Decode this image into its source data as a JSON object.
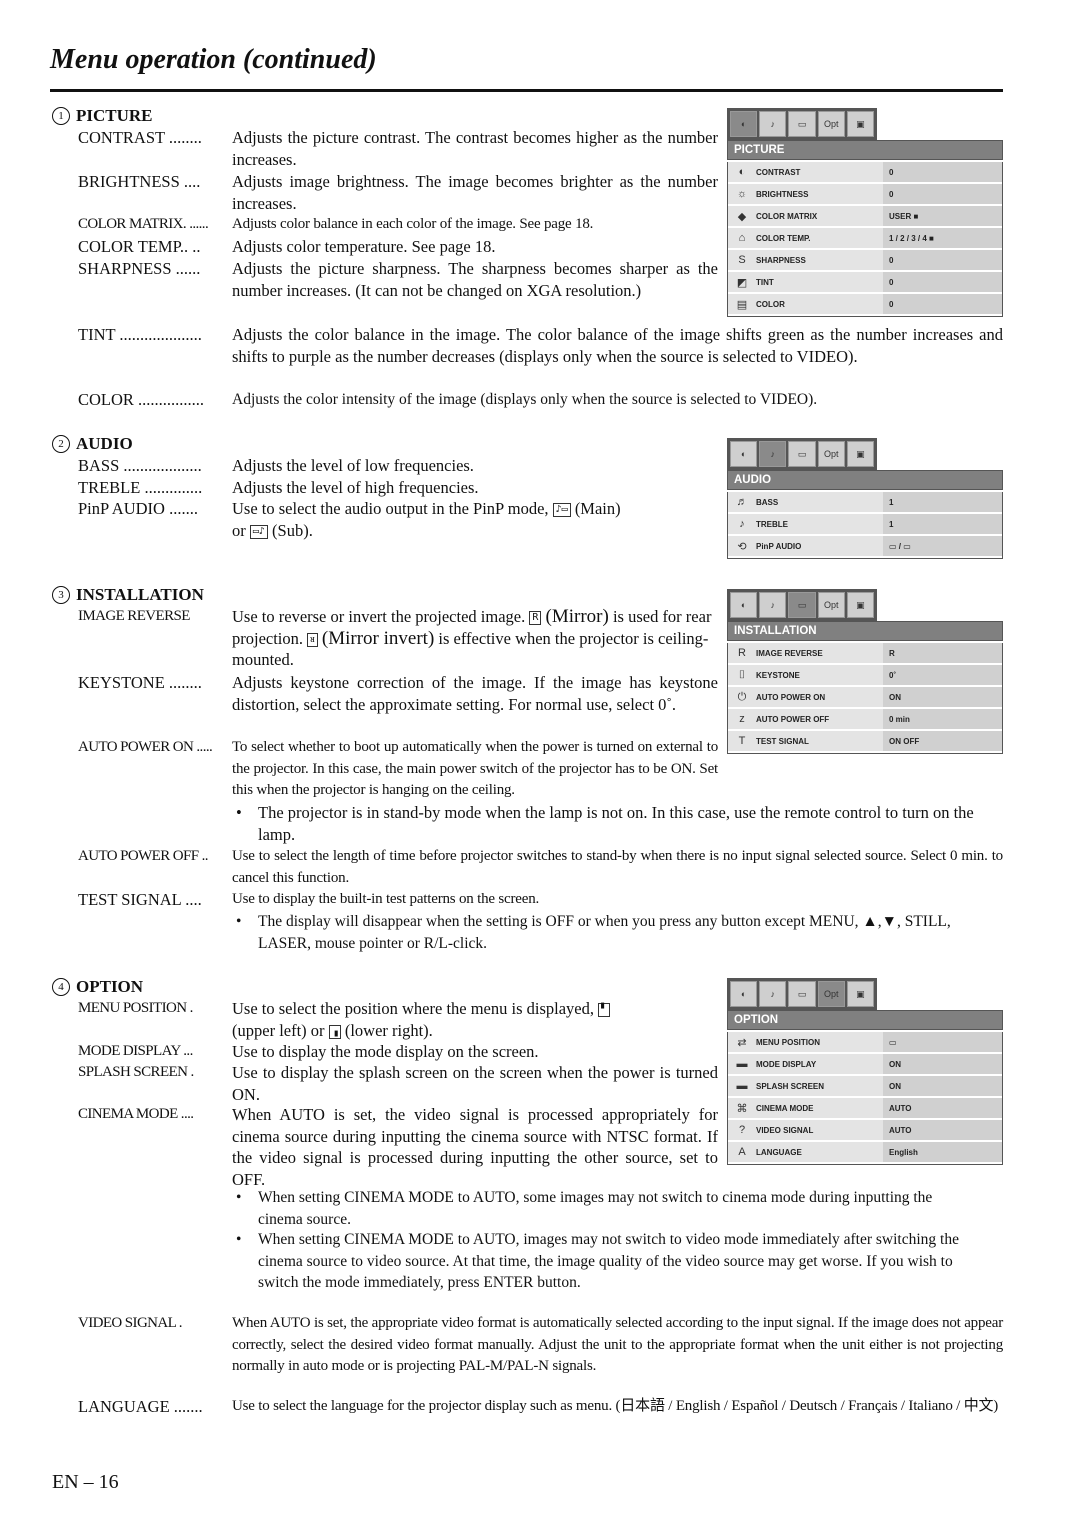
{
  "title": "Menu operation (continued)",
  "page_number": "EN – 16",
  "sections": {
    "picture": {
      "num": "1",
      "heading": "PICTURE",
      "entries": [
        {
          "label": "CONTRAST ........",
          "desc": "Adjusts the picture contrast. The contrast becomes higher as the number increases."
        },
        {
          "label": "BRIGHTNESS ....",
          "desc": "Adjusts image brightness. The image becomes brighter as the number increases."
        },
        {
          "label": "COLOR MATRIX. ......",
          "desc": "Adjusts color balance in each color of the image. See page 18."
        },
        {
          "label": "COLOR TEMP.. ..",
          "desc": "Adjusts color temperature. See page 18."
        },
        {
          "label": "SHARPNESS ......",
          "desc": "Adjusts the picture sharpness. The sharpness becomes sharper as the number increases. (It can not be changed on XGA resolution.)"
        },
        {
          "label": "TINT ....................",
          "desc": "Adjusts the color balance in the image. The color balance of the image shifts green as the number increases and shifts to purple as the number decreases (displays only when the source is selected to VIDEO)."
        },
        {
          "label": "COLOR ................",
          "desc": "Adjusts the color intensity of the image (displays only when the source is selected to VIDEO)."
        }
      ]
    },
    "audio": {
      "num": "2",
      "heading": "AUDIO",
      "entries": [
        {
          "label": "BASS ...................",
          "desc": "Adjusts the level of low frequencies."
        },
        {
          "label": "TREBLE ..............",
          "desc": "Adjusts the level of high frequencies."
        },
        {
          "label": "PinP AUDIO .......",
          "desc_a": "Use to select the audio output in the PinP mode,",
          "main": "(Main)",
          "desc_b": "or",
          "sub": "(Sub)."
        }
      ]
    },
    "installation": {
      "num": "3",
      "heading": "INSTALLATION",
      "entries": [
        {
          "label": "IMAGE REVERSE",
          "desc_a": "Use to reverse or invert the projected image.",
          "mirror": "(Mirror)",
          "desc_b": "is used for rear projection.",
          "mirror_invert": "(Mirror invert)",
          "desc_c": "is effective when the projector is ceiling-mounted."
        },
        {
          "label": "KEYSTONE ........",
          "desc": "Adjusts keystone correction of the image. If the image has keystone distortion, select the approximate setting. For normal use, select 0˚."
        },
        {
          "label": "AUTO POWER ON .....",
          "desc": "To select whether to boot up automatically when the power is turned on external to the projector. In this case, the main power switch of the projector has to be ON. Set this when the projector is hanging on the ceiling."
        },
        {
          "label": "AUTO POWER OFF ..",
          "desc": "Use to select the length of time before projector switches to stand-by when there is no input signal selected source. Select 0 min. to cancel this function."
        },
        {
          "label": "TEST SIGNAL ....",
          "desc": "Use to display the built-in test patterns on the screen."
        }
      ],
      "bullets": [
        "The projector is in stand-by mode when the lamp is not on. In this case, use the remote control to turn on the lamp.",
        "The display will disappear when the setting is OFF or when you press any button except MENU, ▲,▼, STILL, LASER, mouse pointer or R/L-click."
      ]
    },
    "option": {
      "num": "4",
      "heading": "OPTION",
      "entries": [
        {
          "label": "MENU POSITION .",
          "desc_a": "Use to select the position where the menu is displayed,",
          "ul": "(upper left) or",
          "lr": "(lower right)."
        },
        {
          "label": "MODE DISPLAY ...",
          "desc": "Use to display the mode display on the screen."
        },
        {
          "label": "SPLASH SCREEN .",
          "desc": "Use to display the splash screen on the screen when the power is turned ON."
        },
        {
          "label": "CINEMA MODE ....",
          "desc": "When AUTO is set, the video signal is processed appropriately for cinema source during inputting the cinema source with NTSC format. If the video signal is processed during inputting the other source, set to OFF."
        },
        {
          "label": "VIDEO SIGNAL .",
          "desc": "When AUTO is set, the appropriate video format is automatically selected according to the input signal. If the image does not appear correctly, select the desired video format manually. Adjust the unit to the appropriate format when the unit either is not projecting normally in auto mode or is projecting PAL-M/PAL-N signals."
        },
        {
          "label": "LANGUAGE .......",
          "desc": "Use to select the language for the projector display such as menu. (日本語 / English / Español / Deutsch / Français / Italiano / 中文)"
        }
      ],
      "bullets": [
        "When setting CINEMA MODE to AUTO, some images may not switch to cinema mode during inputting the cinema source.",
        "When setting CINEMA MODE to AUTO, images may not switch to video mode immediately after switching the cinema source to video source. At that time, the image quality of the video source may get worse. If you wish to switch the mode immediately, press ENTER button."
      ]
    }
  },
  "osd_tabs": [
    "picture-tab",
    "audio-tab",
    "installation-tab",
    "Opt",
    "lamp-tab"
  ],
  "osd": {
    "picture": {
      "title": "PICTURE",
      "rows": [
        {
          "icon": "◐",
          "name": "CONTRAST",
          "value": "0"
        },
        {
          "icon": "☼",
          "name": "BRIGHTNESS",
          "value": "0"
        },
        {
          "icon": "◆",
          "name": "COLOR MATRIX",
          "value": "USER ■"
        },
        {
          "icon": "⌂",
          "name": "COLOR TEMP.",
          "value": "1 / 2 / 3 / 4 ■"
        },
        {
          "icon": "S",
          "name": "SHARPNESS",
          "value": "0"
        },
        {
          "icon": "◩",
          "name": "TINT",
          "value": "0"
        },
        {
          "icon": "▤",
          "name": "COLOR",
          "value": "0"
        }
      ]
    },
    "audio": {
      "title": "AUDIO",
      "rows": [
        {
          "icon": "♬",
          "name": "BASS",
          "value": "1"
        },
        {
          "icon": "♪",
          "name": "TREBLE",
          "value": "1"
        },
        {
          "icon": "⟲",
          "name": "PinP AUDIO",
          "value": "▭ / ▭"
        }
      ]
    },
    "installation": {
      "title": "INSTALLATION",
      "rows": [
        {
          "icon": "R",
          "name": "IMAGE REVERSE",
          "value": "R"
        },
        {
          "icon": "⌷",
          "name": "KEYSTONE",
          "value": "0˚"
        },
        {
          "icon": "⏻",
          "name": "AUTO POWER ON",
          "value": "ON"
        },
        {
          "icon": "z",
          "name": "AUTO POWER OFF",
          "value": "0    min"
        },
        {
          "icon": "T",
          "name": "TEST SIGNAL",
          "value": "ON   OFF"
        }
      ]
    },
    "option": {
      "title": "OPTION",
      "rows": [
        {
          "icon": "⇄",
          "name": "MENU POSITION",
          "value": "▭"
        },
        {
          "icon": "▬",
          "name": "MODE DISPLAY",
          "value": "ON"
        },
        {
          "icon": "▬",
          "name": "SPLASH SCREEN",
          "value": "ON"
        },
        {
          "icon": "⌘",
          "name": "CINEMA MODE",
          "value": "AUTO"
        },
        {
          "icon": "?",
          "name": "VIDEO SIGNAL",
          "value": "AUTO"
        },
        {
          "icon": "A",
          "name": "LANGUAGE",
          "value": "English"
        }
      ]
    }
  }
}
